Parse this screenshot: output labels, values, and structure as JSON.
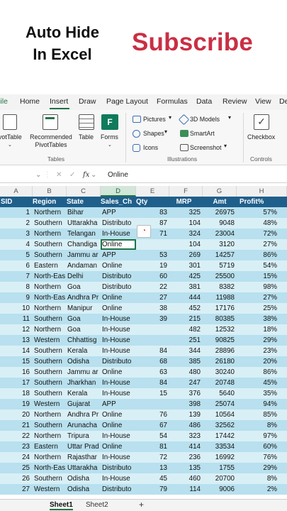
{
  "banner": {
    "line1": "Auto Hide",
    "line2": "In Excel",
    "subscribe": "Subscribe"
  },
  "tabs": [
    "File",
    "Home",
    "Insert",
    "Draw",
    "Page Layout",
    "Formulas",
    "Data",
    "Review",
    "View",
    "De"
  ],
  "ribbon": {
    "pivot": "ivotTable",
    "recommended1": "Recommended",
    "recommended2": "PivotTables",
    "table": "Table",
    "forms": "Forms",
    "tables_group": "Tables",
    "pictures": "Pictures",
    "shapes": "Shapes",
    "icons": "Icons",
    "models": "3D Models",
    "smartart": "SmartArt",
    "screenshot": "Screenshot",
    "illustrations_group": "Illustrations",
    "checkbox": "Checkbox",
    "controls_group": "Controls"
  },
  "formula_bar": {
    "fx": "fx",
    "value": "Online"
  },
  "columns": [
    "A",
    "B",
    "C",
    "D",
    "E",
    "F",
    "G",
    "H"
  ],
  "headers": [
    "SID",
    "Region",
    "State",
    "Sales_Ch",
    "Qty",
    "MRP",
    "Amt",
    "Profit%"
  ],
  "rows": [
    [
      "1",
      "Northern",
      "Bihar",
      "APP",
      "83",
      "325",
      "26975",
      "57%"
    ],
    [
      "2",
      "Southern",
      "Uttarakha",
      "Distributo",
      "87",
      "104",
      "9048",
      "48%"
    ],
    [
      "3",
      "Northern",
      "Telangan",
      "In-House",
      "71",
      "324",
      "23004",
      "72%"
    ],
    [
      "4",
      "Southern",
      "Chandiga",
      "Online",
      "",
      "104",
      "3120",
      "27%"
    ],
    [
      "5",
      "Southern",
      "Jammu ar",
      "APP",
      "53",
      "269",
      "14257",
      "86%"
    ],
    [
      "6",
      "Eastern",
      "Andaman",
      "Online",
      "19",
      "301",
      "5719",
      "54%"
    ],
    [
      "7",
      "North-Eas",
      "Delhi",
      "Distributo",
      "60",
      "425",
      "25500",
      "15%"
    ],
    [
      "8",
      "Northern",
      "Goa",
      "Distributo",
      "22",
      "381",
      "8382",
      "98%"
    ],
    [
      "9",
      "North-Eas",
      "Andhra Pr",
      "Online",
      "27",
      "444",
      "11988",
      "27%"
    ],
    [
      "10",
      "Northern",
      "Manipur",
      "Online",
      "38",
      "452",
      "17176",
      "25%"
    ],
    [
      "11",
      "Southern",
      "Goa",
      "In-House",
      "39",
      "215",
      "80385",
      "38%"
    ],
    [
      "12",
      "Northern",
      "Goa",
      "In-House",
      "",
      "482",
      "12532",
      "18%"
    ],
    [
      "13",
      "Western",
      "Chhattisg",
      "In-House",
      "",
      "251",
      "90825",
      "29%"
    ],
    [
      "14",
      "Southern",
      "Kerala",
      "In-House",
      "84",
      "344",
      "28896",
      "23%"
    ],
    [
      "15",
      "Southern",
      "Odisha",
      "Distributo",
      "68",
      "385",
      "26180",
      "20%"
    ],
    [
      "16",
      "Southern",
      "Jammu ar",
      "Online",
      "63",
      "480",
      "30240",
      "86%"
    ],
    [
      "17",
      "Southern",
      "Jharkhan",
      "In-House",
      "84",
      "247",
      "20748",
      "45%"
    ],
    [
      "18",
      "Southern",
      "Kerala",
      "In-House",
      "15",
      "376",
      "5640",
      "35%"
    ],
    [
      "19",
      "Western",
      "Gujarat",
      "APP",
      "",
      "398",
      "25074",
      "94%"
    ],
    [
      "20",
      "Northern",
      "Andhra Pr",
      "Online",
      "76",
      "139",
      "10564",
      "85%"
    ],
    [
      "21",
      "Southern",
      "Arunacha",
      "Online",
      "67",
      "486",
      "32562",
      "8%"
    ],
    [
      "22",
      "Northern",
      "Tripura",
      "In-House",
      "54",
      "323",
      "17442",
      "97%"
    ],
    [
      "23",
      "Eastern",
      "Uttar Prad",
      "Online",
      "81",
      "414",
      "33534",
      "60%"
    ],
    [
      "24",
      "Northern",
      "Rajasthar",
      "In-House",
      "72",
      "236",
      "16992",
      "76%"
    ],
    [
      "25",
      "North-Eas",
      "Uttarakha",
      "Distributo",
      "13",
      "135",
      "1755",
      "29%"
    ],
    [
      "26",
      "Southern",
      "Odisha",
      "In-House",
      "45",
      "460",
      "20700",
      "8%"
    ],
    [
      "27",
      "Western",
      "Odisha",
      "Distributo",
      "79",
      "114",
      "9006",
      "2%"
    ]
  ],
  "sheets": [
    "Sheet1",
    "Sheet2",
    "+"
  ]
}
